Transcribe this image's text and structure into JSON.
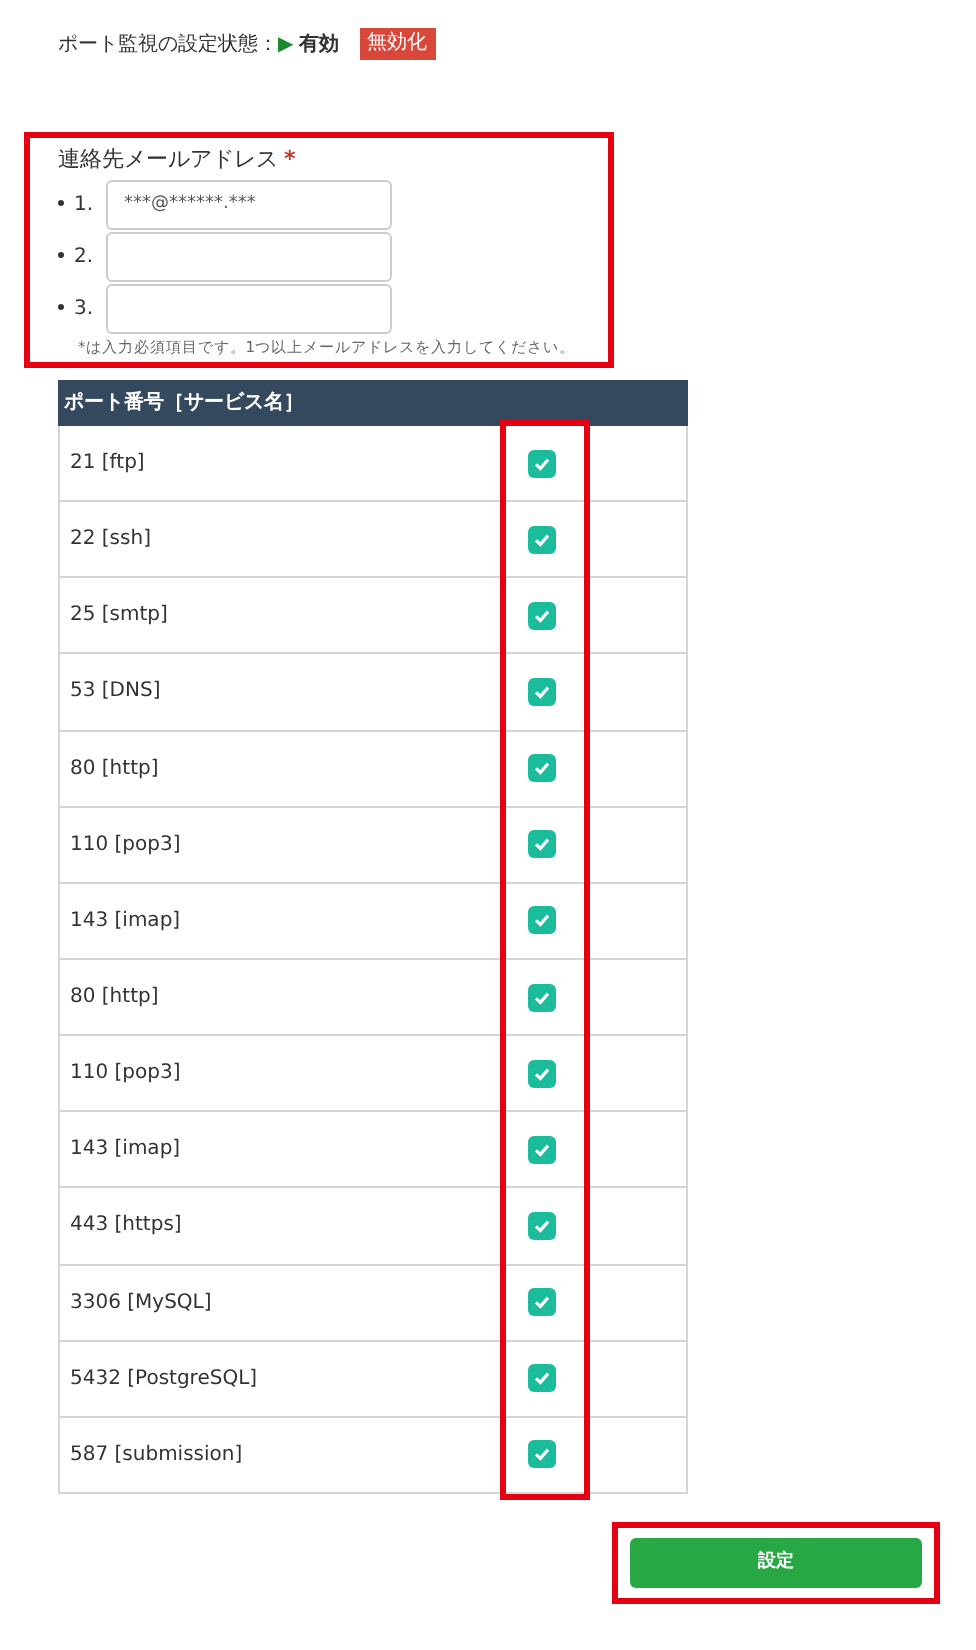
{
  "status": {
    "label": "ポート監視の設定状態：",
    "indicator": "▶",
    "value": "有効",
    "action": "無効化"
  },
  "email_section": {
    "label": "連絡先メールアドレス",
    "required_mark": "*",
    "fields": [
      {
        "number": "1.",
        "value": "***@******.***"
      },
      {
        "number": "2."
      },
      {
        "number": "3."
      }
    ],
    "note": "*は入力必須項目です。1つ以上メールアドレスを入力してください。"
  },
  "table": {
    "columns": [
      "ポート番号［サービス名］"
    ],
    "rows": [
      {
        "port": "21 [ftp]",
        "checked": true
      },
      {
        "port": "22 [ssh]",
        "checked": true
      },
      {
        "port": "25 [smtp]",
        "checked": true
      },
      {
        "port": "53 [DNS]",
        "checked": true
      },
      {
        "port": "80 [http]",
        "checked": true
      },
      {
        "port": "110 [pop3]",
        "checked": true
      },
      {
        "port": "143 [imap]",
        "checked": true
      },
      {
        "port": "80 [http]",
        "checked": true
      },
      {
        "port": "110 [pop3]",
        "checked": true
      },
      {
        "port": "143 [imap]",
        "checked": true
      },
      {
        "port": "443 [https]",
        "checked": true
      },
      {
        "port": "3306 [MySQL]",
        "checked": true
      },
      {
        "port": "5432 [PostgreSQL]",
        "checked": true
      },
      {
        "port": "587 [submission]",
        "checked": true
      }
    ]
  },
  "submit_button": "設定"
}
